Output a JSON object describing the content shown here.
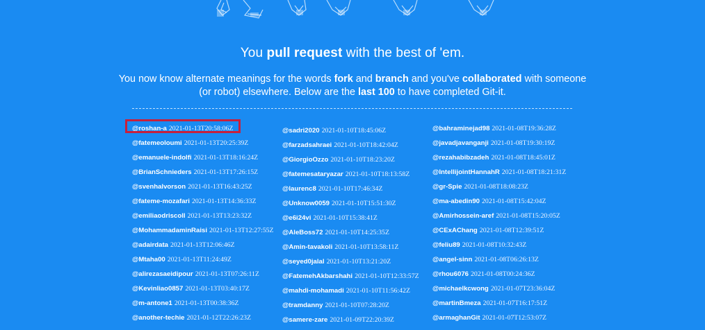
{
  "headline": {
    "prefix": "You ",
    "bold": "pull request",
    "suffix": " with the best of 'em."
  },
  "intro": {
    "t1": "You now know alternate meanings for the words ",
    "b1": "fork",
    "t2": " and ",
    "b2": "branch",
    "t3": " and you've ",
    "b3": "collaborated",
    "t4": " with someone (or robot) elsewhere. Below are the ",
    "b4": "last 100",
    "t5": " to have completed Git-it."
  },
  "columns": [
    [
      {
        "user": "@roshan-a",
        "time": "2021-01-13T20:58:06Z"
      },
      {
        "user": "@fatemeoloumi",
        "time": "2021-01-13T20:25:39Z"
      },
      {
        "user": "@emanuele-indolfi",
        "time": "2021-01-13T18:16:24Z"
      },
      {
        "user": "@BrianSchnieders",
        "time": "2021-01-13T17:26:15Z"
      },
      {
        "user": "@svenhalvorson",
        "time": "2021-01-13T16:43:25Z"
      },
      {
        "user": "@fateme-mozafari",
        "time": "2021-01-13T14:36:33Z"
      },
      {
        "user": "@emiliaodriscoll",
        "time": "2021-01-13T13:23:32Z"
      },
      {
        "user": "@MohammadaminRaisi",
        "time": "2021-01-13T12:27:55Z"
      },
      {
        "user": "@adairdata",
        "time": "2021-01-13T12:06:46Z"
      },
      {
        "user": "@Mtaha00",
        "time": "2021-01-13T11:24:49Z"
      },
      {
        "user": "@alirezasaeidipour",
        "time": "2021-01-13T07:26:11Z"
      },
      {
        "user": "@Kevinliao0857",
        "time": "2021-01-13T03:40:17Z"
      },
      {
        "user": "@m-antone1",
        "time": "2021-01-13T00:38:36Z"
      },
      {
        "user": "@another-techie",
        "time": "2021-01-12T22:26:23Z"
      }
    ],
    [
      {
        "user": "@sadri2020",
        "time": "2021-01-10T18:45:06Z"
      },
      {
        "user": "@farzadsahraei",
        "time": "2021-01-10T18:42:04Z"
      },
      {
        "user": "@GiorgioOzzo",
        "time": "2021-01-10T18:23:20Z"
      },
      {
        "user": "@fatemesataryazar",
        "time": "2021-01-10T18:13:58Z"
      },
      {
        "user": "@laurenc8",
        "time": "2021-01-10T17:46:34Z"
      },
      {
        "user": "@Unknow0059",
        "time": "2021-01-10T15:51:30Z"
      },
      {
        "user": "@e6i24vi",
        "time": "2021-01-10T15:38:41Z"
      },
      {
        "user": "@AleBoss72",
        "time": "2021-01-10T14:25:35Z"
      },
      {
        "user": "@Amin-tavakoli",
        "time": "2021-01-10T13:58:11Z"
      },
      {
        "user": "@seyed0jalal",
        "time": "2021-01-10T13:21:20Z"
      },
      {
        "user": "@FatemehAkbarshahi",
        "time": "2021-01-10T12:33:57Z"
      },
      {
        "user": "@mahdi-mohamadi",
        "time": "2021-01-10T11:56:42Z"
      },
      {
        "user": "@tramdanny",
        "time": "2021-01-10T07:28:20Z"
      },
      {
        "user": "@samere-zare",
        "time": "2021-01-09T22:20:39Z"
      }
    ],
    [
      {
        "user": "@bahraminejad98",
        "time": "2021-01-08T19:36:28Z"
      },
      {
        "user": "@javadjavanganji",
        "time": "2021-01-08T19:30:19Z"
      },
      {
        "user": "@rezahabibzadeh",
        "time": "2021-01-08T18:45:01Z"
      },
      {
        "user": "@IntellijointHannahR",
        "time": "2021-01-08T18:21:31Z"
      },
      {
        "user": "@gr-Spie",
        "time": "2021-01-08T18:08:23Z"
      },
      {
        "user": "@ma-abedin90",
        "time": "2021-01-08T15:42:04Z"
      },
      {
        "user": "@Amirhossein-aref",
        "time": "2021-01-08T15:20:05Z"
      },
      {
        "user": "@CExAChang",
        "time": "2021-01-08T12:39:51Z"
      },
      {
        "user": "@feliu89",
        "time": "2021-01-08T10:32:43Z"
      },
      {
        "user": "@angel-sinn",
        "time": "2021-01-08T06:26:13Z"
      },
      {
        "user": "@rhou6076",
        "time": "2021-01-08T00:24:36Z"
      },
      {
        "user": "@michaelkcwong",
        "time": "2021-01-07T23:36:04Z"
      },
      {
        "user": "@martinBmeza",
        "time": "2021-01-07T16:17:51Z"
      },
      {
        "user": "@armaghanGit",
        "time": "2021-01-07T12:53:07Z"
      }
    ]
  ],
  "highlighted_user": "@roshan-a",
  "colors": {
    "background": "#1A8BF2",
    "text": "#ffffff",
    "highlight": "#C8203C"
  }
}
